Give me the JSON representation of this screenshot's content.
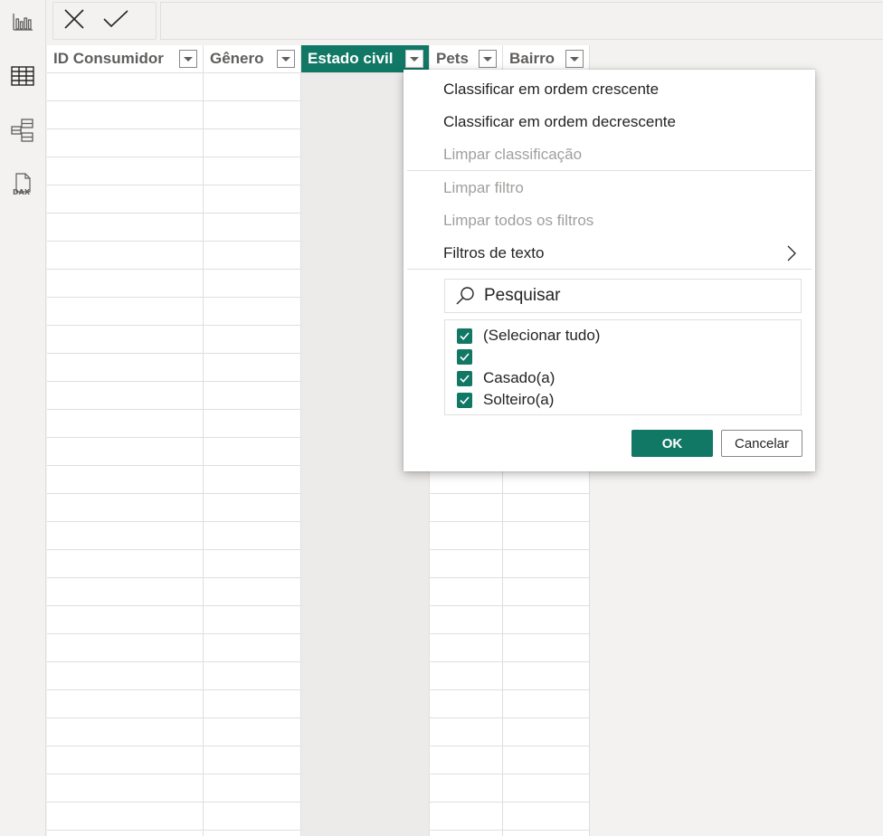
{
  "formula_bar": {
    "cancel_icon": "close-icon",
    "commit_icon": "checkmark-icon",
    "value": ""
  },
  "left_rail": [
    {
      "name": "report-view",
      "icon": "bar-chart-icon",
      "active": false
    },
    {
      "name": "data-view",
      "icon": "table-icon",
      "active": true
    },
    {
      "name": "model-view",
      "icon": "model-icon",
      "active": false
    },
    {
      "name": "dax-query-view",
      "icon": "dax-icon",
      "active": false
    }
  ],
  "table": {
    "columns": [
      {
        "label": "ID Consumidor"
      },
      {
        "label": "Gênero"
      },
      {
        "label": "Estado civil",
        "selected": true
      },
      {
        "label": "Pets"
      },
      {
        "label": "Bairro"
      }
    ]
  },
  "filter_menu": {
    "items": [
      {
        "label": "Classificar em ordem crescente",
        "enabled": true
      },
      {
        "label": "Classificar em ordem decrescente",
        "enabled": true
      },
      {
        "label": "Limpar classificação",
        "enabled": false
      },
      {
        "label": "Limpar filtro",
        "enabled": false
      },
      {
        "label": "Limpar todos os filtros",
        "enabled": false
      },
      {
        "label": "Filtros de texto",
        "enabled": true,
        "submenu": true
      }
    ],
    "search_placeholder": "Pesquisar",
    "values": [
      {
        "label": "(Selecionar tudo)",
        "checked": true
      },
      {
        "label": "",
        "checked": true
      },
      {
        "label": "Casado(a)",
        "checked": true
      },
      {
        "label": "Solteiro(a)",
        "checked": true
      }
    ],
    "ok_label": "OK",
    "cancel_label": "Cancelar"
  },
  "colors": {
    "accent": "#117865",
    "background": "#f3f2f1",
    "gridline": "#e1dfdd",
    "selected_column": "#edebe9",
    "disabled_text": "#a19f9d"
  }
}
